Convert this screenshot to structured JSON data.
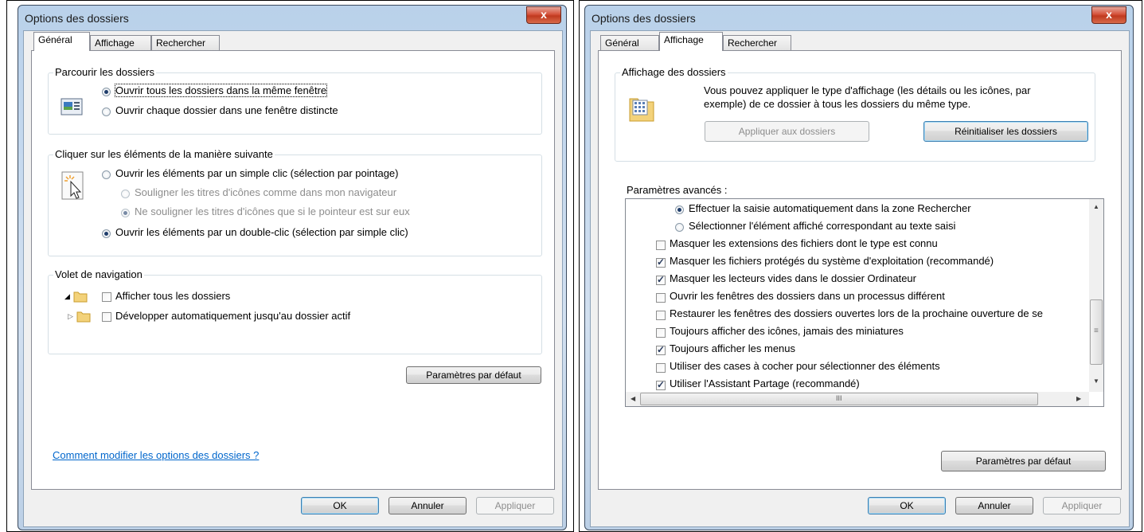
{
  "left": {
    "title": "Options des dossiers",
    "close": "x",
    "tabs": [
      "Général",
      "Affichage",
      "Rechercher"
    ],
    "browse_group": "Parcourir les dossiers",
    "browse_same": "Ouvrir tous les dossiers dans la même fenêtre",
    "browse_new": "Ouvrir chaque dossier dans une fenêtre distincte",
    "click_group": "Cliquer sur les éléments de la manière suivante",
    "single_click": "Ouvrir les éléments par un simple clic (sélection par pointage)",
    "underline_browser": "Souligner les titres d'icônes comme dans mon navigateur",
    "underline_hover": "Ne souligner les titres d'icônes que si le pointeur est sur eux",
    "double_click": "Ouvrir les éléments par un double-clic (sélection par simple clic)",
    "nav_group": "Volet de navigation",
    "show_all": "Afficher tous les dossiers",
    "auto_expand": "Développer automatiquement jusqu'au dossier actif",
    "defaults": "Paramètres par défaut",
    "help_link": "Comment modifier les options des dossiers ?",
    "ok": "OK",
    "cancel": "Annuler",
    "apply": "Appliquer"
  },
  "right": {
    "title": "Options des dossiers",
    "close": "x",
    "tabs": [
      "Général",
      "Affichage",
      "Rechercher"
    ],
    "view_group": "Affichage des dossiers",
    "view_desc_1": "Vous pouvez appliquer le type d'affichage (les détails ou les icônes, par",
    "view_desc_2": "exemple) de ce dossier à tous les dossiers du même type.",
    "apply_folders": "Appliquer aux dossiers",
    "reset_folders": "Réinitialiser les dossiers",
    "advanced_label": "Paramètres avancés :",
    "items": [
      {
        "kind": "radio",
        "on": true,
        "text": "Effectuer la saisie automatiquement dans la zone Rechercher"
      },
      {
        "kind": "radio",
        "on": false,
        "text": "Sélectionner l'élément affiché correspondant au texte saisi"
      },
      {
        "kind": "check",
        "on": false,
        "text": "Masquer les extensions des fichiers dont le type est connu"
      },
      {
        "kind": "check",
        "on": true,
        "text": "Masquer les fichiers protégés du système d'exploitation (recommandé)"
      },
      {
        "kind": "check",
        "on": true,
        "text": "Masquer les lecteurs vides dans le dossier Ordinateur"
      },
      {
        "kind": "check",
        "on": false,
        "text": "Ouvrir les fenêtres des dossiers dans un processus différent"
      },
      {
        "kind": "check",
        "on": false,
        "text": "Restaurer les fenêtres des dossiers ouvertes lors de la prochaine ouverture de se"
      },
      {
        "kind": "check",
        "on": false,
        "text": "Toujours afficher des icônes, jamais des miniatures"
      },
      {
        "kind": "check",
        "on": true,
        "text": "Toujours afficher les menus"
      },
      {
        "kind": "check",
        "on": false,
        "text": "Utiliser des cases à cocher pour sélectionner des éléments"
      },
      {
        "kind": "check",
        "on": true,
        "text": "Utiliser l'Assistant Partage (recommandé)"
      }
    ],
    "thumb_mark": "III",
    "defaults": "Paramètres par défaut",
    "ok": "OK",
    "cancel": "Annuler",
    "apply": "Appliquer"
  }
}
